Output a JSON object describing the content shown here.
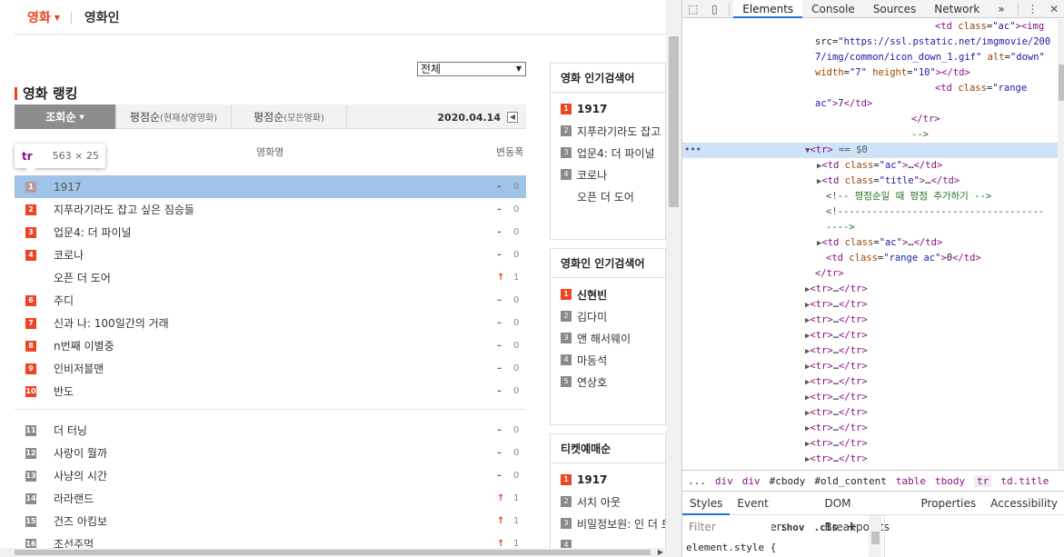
{
  "page": {
    "nav": {
      "active": "영화",
      "other": "영화인"
    },
    "select_value": "전체",
    "ranking_title": "영화 랭킹",
    "tabs": [
      {
        "label": "조회순",
        "sub": ""
      },
      {
        "label": "평점순",
        "sub": "(현재상영영화)"
      },
      {
        "label": "평점순",
        "sub": "(모든영화)"
      }
    ],
    "date": "2020.04.14",
    "tooltip": {
      "tag": "tr",
      "size": "563 × 25"
    },
    "col_title": "영화명",
    "col_change": "변동폭",
    "rankings": [
      {
        "rank": "1",
        "title": "1917",
        "mark": "–",
        "change": "0"
      },
      {
        "rank": "2",
        "title": "지푸라기라도 잡고 싶은 짐승들",
        "mark": "–",
        "change": "0"
      },
      {
        "rank": "3",
        "title": "업문4: 더 파이널",
        "mark": "–",
        "change": "0"
      },
      {
        "rank": "4",
        "title": "코로나",
        "mark": "–",
        "change": "0"
      },
      {
        "rank": "",
        "title": "오픈 더 도어",
        "mark": "↑",
        "change": "1"
      },
      {
        "rank": "6",
        "title": "주디",
        "mark": "–",
        "change": "0"
      },
      {
        "rank": "7",
        "title": "신과 나: 100일간의 거래",
        "mark": "–",
        "change": "0"
      },
      {
        "rank": "8",
        "title": "n번째 이별중",
        "mark": "–",
        "change": "0"
      },
      {
        "rank": "9",
        "title": "인비저블맨",
        "mark": "–",
        "change": "0"
      },
      {
        "rank": "10",
        "title": "반도",
        "mark": "–",
        "change": "0"
      },
      {
        "rank": "11",
        "title": "더 터닝",
        "mark": "–",
        "change": "0"
      },
      {
        "rank": "12",
        "title": "사랑이 뭘까",
        "mark": "–",
        "change": "0"
      },
      {
        "rank": "13",
        "title": "사냥의 시간",
        "mark": "–",
        "change": "0"
      },
      {
        "rank": "14",
        "title": "라라랜드",
        "mark": "↑",
        "change": "1"
      },
      {
        "rank": "15",
        "title": "건즈 아킴보",
        "mark": "↑",
        "change": "1"
      },
      {
        "rank": "16",
        "title": "조선주먹",
        "mark": "↑",
        "change": "1"
      }
    ],
    "side_boxes": [
      {
        "title": "영화 인기검색어",
        "items": [
          {
            "n": "1",
            "text": "1917"
          },
          {
            "n": "2",
            "text": "지푸라기라도 잡고 싶은 짐승들"
          },
          {
            "n": "3",
            "text": "업문4: 더 파이널"
          },
          {
            "n": "4",
            "text": "코로나"
          },
          {
            "n": "",
            "text": "오픈 더 도어"
          }
        ]
      },
      {
        "title": "영화인 인기검색어",
        "items": [
          {
            "n": "1",
            "text": "신현빈"
          },
          {
            "n": "2",
            "text": "김다미"
          },
          {
            "n": "3",
            "text": "앤 해서웨이"
          },
          {
            "n": "4",
            "text": "마동석"
          },
          {
            "n": "5",
            "text": "연상호"
          }
        ]
      },
      {
        "title": "티켓예매순",
        "items": [
          {
            "n": "1",
            "text": "1917"
          },
          {
            "n": "2",
            "text": "서치 아웃"
          },
          {
            "n": "3",
            "text": "비밀정보원: 인 더 트랩"
          },
          {
            "n": "4",
            "text": ""
          }
        ]
      }
    ]
  },
  "devtools": {
    "tabs": [
      "Elements",
      "Console",
      "Sources",
      "Network",
      "»"
    ],
    "dom_lines": [
      {
        "html": "<span class='tg'>&lt;td</span> <span class='an'>class</span>=<span class='av'>\"ac\"</span><span class='tg'>&gt;&lt;img</span>",
        "indent": 278,
        "sel": false
      },
      {
        "html": "src=<span class='av'>\"https://ssl.pstatic.net/imgmovie/200</span>",
        "indent": 146,
        "sel": false
      },
      {
        "html": "<span class='av'>7/img/common/icon_down_1.gif\"</span> <span class='an'>alt</span>=<span class='av'>\"down\"</span>",
        "indent": 146,
        "sel": false
      },
      {
        "html": "<span class='an'>width</span>=<span class='av'>\"7\"</span> <span class='an'>height</span>=<span class='av'>\"10\"</span><span class='tg'>&gt;&lt;/td&gt;</span>",
        "indent": 146,
        "sel": false
      },
      {
        "html": "<span class='tg'>&lt;td</span> <span class='an'>class</span>=<span class='av'>\"range</span>",
        "indent": 278,
        "sel": false
      },
      {
        "html": "<span class='av'>ac\"</span><span class='tg'>&gt;</span>7<span class='tg'>&lt;/td&gt;</span>",
        "indent": 146,
        "sel": false
      },
      {
        "html": "<span class='tg'>&lt;/tr&gt;</span>",
        "indent": 252,
        "sel": false
      },
      {
        "html": "<span class='cm'>--&gt;</span>",
        "indent": 252,
        "sel": false
      },
      {
        "html": "<span class='tri'>▼</span><span class='tg'>&lt;tr&gt;</span> <span style='color:#555'>== $0</span>",
        "indent": 135,
        "sel": true
      },
      {
        "html": "<span class='tri'>▶</span><span class='tg'>&lt;td</span> <span class='an'>class</span>=<span class='av'>\"ac\"</span><span class='tg'>&gt;</span>…<span class='tg'>&lt;/td&gt;</span>",
        "indent": 148,
        "sel": false
      },
      {
        "html": "<span class='tri'>▶</span><span class='tg'>&lt;td</span> <span class='an'>class</span>=<span class='av'>\"title\"</span><span class='tg'>&gt;</span>…<span class='tg'>&lt;/td&gt;</span>",
        "indent": 148,
        "sel": false
      },
      {
        "html": "<span class='cm'>&lt;!-- 평점순일 때 평점 추가하기  --&gt;</span>",
        "indent": 158,
        "sel": false
      },
      {
        "html": "<span class='cm'>&lt;!------------------------------------</span>",
        "indent": 158,
        "sel": false
      },
      {
        "html": "<span class='cm'>----&gt;</span>",
        "indent": 158,
        "sel": false
      },
      {
        "html": "<span class='tri'>▶</span><span class='tg'>&lt;td</span> <span class='an'>class</span>=<span class='av'>\"ac\"</span><span class='tg'>&gt;</span>…<span class='tg'>&lt;/td&gt;</span>",
        "indent": 148,
        "sel": false
      },
      {
        "html": "<span class='tg'>&lt;td</span> <span class='an'>class</span>=<span class='av'>\"range ac\"</span><span class='tg'>&gt;</span>0<span class='tg'>&lt;/td&gt;</span>",
        "indent": 158,
        "sel": false
      },
      {
        "html": "<span class='tg'>&lt;/tr&gt;</span>",
        "indent": 146,
        "sel": false
      },
      {
        "html": "<span class='tri'>▶</span><span class='tg'>&lt;tr&gt;</span>…<span class='tg'>&lt;/tr&gt;</span>",
        "indent": 135,
        "sel": false
      },
      {
        "html": "<span class='tri'>▶</span><span class='tg'>&lt;tr&gt;</span>…<span class='tg'>&lt;/tr&gt;</span>",
        "indent": 135,
        "sel": false
      },
      {
        "html": "<span class='tri'>▶</span><span class='tg'>&lt;tr&gt;</span>…<span class='tg'>&lt;/tr&gt;</span>",
        "indent": 135,
        "sel": false
      },
      {
        "html": "<span class='tri'>▶</span><span class='tg'>&lt;tr&gt;</span>…<span class='tg'>&lt;/tr&gt;</span>",
        "indent": 135,
        "sel": false
      },
      {
        "html": "<span class='tri'>▶</span><span class='tg'>&lt;tr&gt;</span>…<span class='tg'>&lt;/tr&gt;</span>",
        "indent": 135,
        "sel": false
      },
      {
        "html": "<span class='tri'>▶</span><span class='tg'>&lt;tr&gt;</span>…<span class='tg'>&lt;/tr&gt;</span>",
        "indent": 135,
        "sel": false
      },
      {
        "html": "<span class='tri'>▶</span><span class='tg'>&lt;tr&gt;</span>…<span class='tg'>&lt;/tr&gt;</span>",
        "indent": 135,
        "sel": false
      },
      {
        "html": "<span class='tri'>▶</span><span class='tg'>&lt;tr&gt;</span>…<span class='tg'>&lt;/tr&gt;</span>",
        "indent": 135,
        "sel": false
      },
      {
        "html": "<span class='tri'>▶</span><span class='tg'>&lt;tr&gt;</span>…<span class='tg'>&lt;/tr&gt;</span>",
        "indent": 135,
        "sel": false
      },
      {
        "html": "<span class='tri'>▶</span><span class='tg'>&lt;tr&gt;</span>…<span class='tg'>&lt;/tr&gt;</span>",
        "indent": 135,
        "sel": false
      },
      {
        "html": "<span class='tri'>▶</span><span class='tg'>&lt;tr&gt;</span>…<span class='tg'>&lt;/tr&gt;</span>",
        "indent": 135,
        "sel": false
      },
      {
        "html": "<span class='tri'>▶</span><span class='tg'>&lt;tr&gt;</span>…<span class='tg'>&lt;/tr&gt;</span>",
        "indent": 135,
        "sel": false
      },
      {
        "html": "<span class='tri'>▶</span><span class='tg'>&lt;tr&gt;</span>…<span class='tg'>&lt;/tr&gt;</span>",
        "indent": 135,
        "sel": false
      }
    ],
    "breadcrumbs": [
      "...",
      "div",
      "div",
      "#cbody",
      "#old_content",
      "table",
      "tbody",
      "tr",
      "td.title"
    ],
    "style_tabs": [
      "Styles",
      "Event Listeners",
      "DOM Breakpoints",
      "Properties",
      "Accessibility"
    ],
    "filter_placeholder": "Filter",
    "hov": ":hov",
    "cls": ".cls",
    "element_style": "element.style {"
  }
}
